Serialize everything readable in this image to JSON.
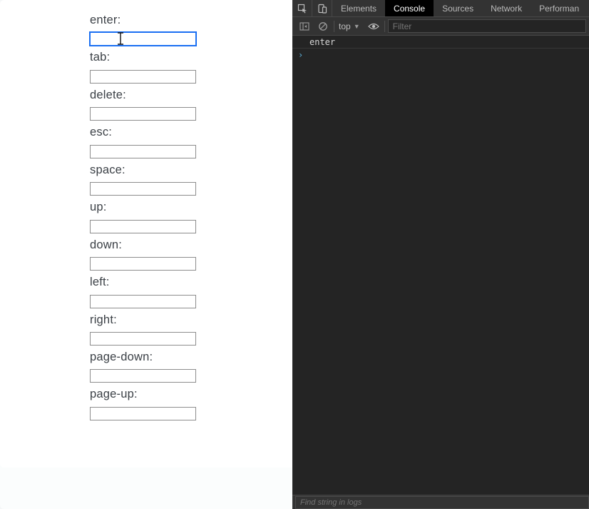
{
  "left": {
    "fields": [
      {
        "label": "enter:",
        "value": "",
        "focused": true
      },
      {
        "label": "tab:",
        "value": "",
        "focused": false
      },
      {
        "label": "delete:",
        "value": "",
        "focused": false
      },
      {
        "label": "esc:",
        "value": "",
        "focused": false
      },
      {
        "label": "space:",
        "value": "",
        "focused": false
      },
      {
        "label": "up:",
        "value": "",
        "focused": false
      },
      {
        "label": "down:",
        "value": "",
        "focused": false
      },
      {
        "label": "left:",
        "value": "",
        "focused": false
      },
      {
        "label": "right:",
        "value": "",
        "focused": false
      },
      {
        "label": "page-down:",
        "value": "",
        "focused": false
      },
      {
        "label": "page-up:",
        "value": "",
        "focused": false
      }
    ]
  },
  "devtools": {
    "tabs": {
      "elements": "Elements",
      "console": "Console",
      "sources": "Sources",
      "network": "Network",
      "performance": "Performan"
    },
    "active_tab": "console",
    "toolbar": {
      "context": "top",
      "filter_placeholder": "Filter"
    },
    "console_log": "enter",
    "footer_placeholder": "Find string in logs"
  }
}
